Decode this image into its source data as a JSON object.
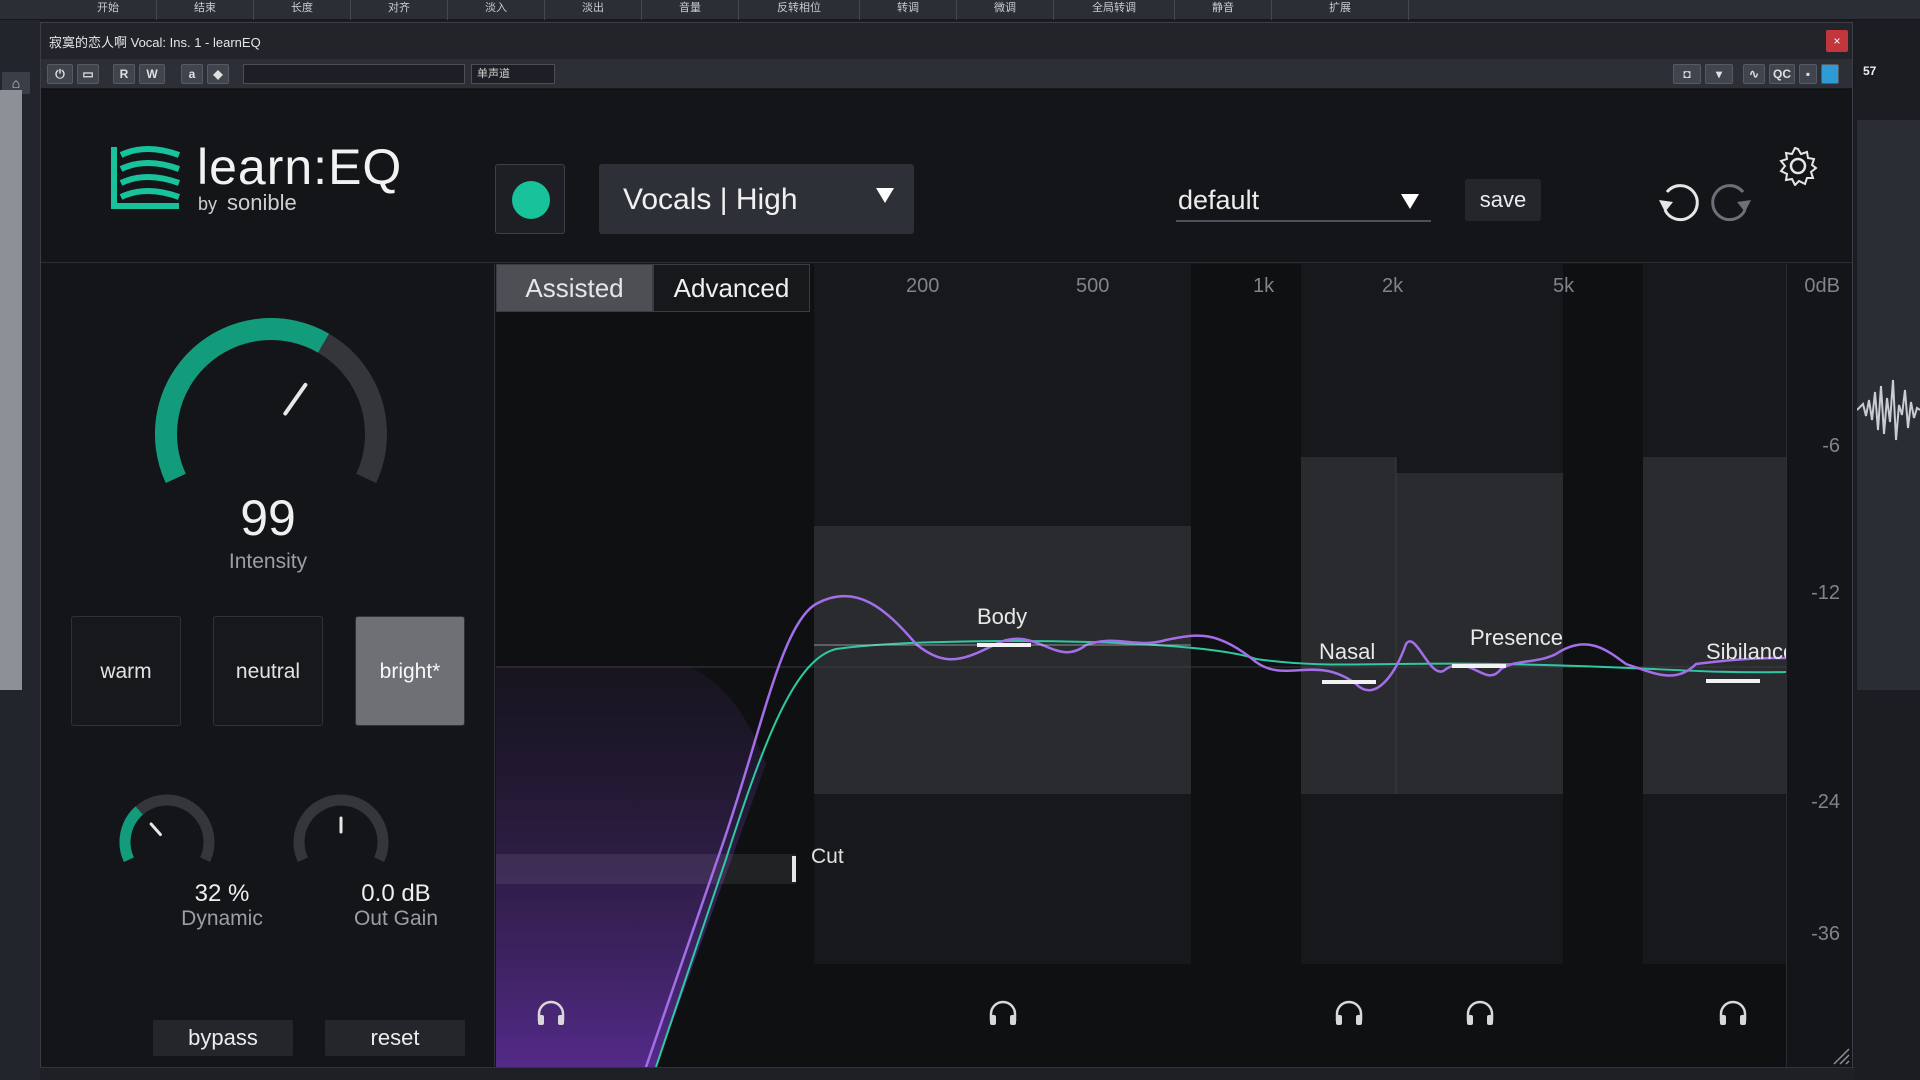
{
  "daw": {
    "menu": [
      "开始",
      "结束",
      "长度",
      "对齐",
      "淡入",
      "淡出",
      "音量",
      "反转相位",
      "转调",
      "微调",
      "全局转调",
      "静音",
      "扩展"
    ],
    "right_number": "57"
  },
  "window": {
    "title": "寂寞的恋人啊 Vocal: Ins. 1 - learnEQ",
    "close_label": "×",
    "toolbar": {
      "power": "⏻",
      "r": "R",
      "w": "W",
      "a": "a",
      "channel_mode": "单声道",
      "qc": "QC"
    }
  },
  "plugin": {
    "logo": {
      "name": "learn:EQ",
      "by": "by",
      "brand": "sonible"
    },
    "profile": "Vocals | High",
    "preset": "default",
    "save_label": "save",
    "intensity": {
      "value": "99",
      "label": "Intensity",
      "fraction": 0.99
    },
    "styles": [
      {
        "label": "warm",
        "active": false
      },
      {
        "label": "neutral",
        "active": false
      },
      {
        "label": "bright*",
        "active": true
      }
    ],
    "dynamic": {
      "value": "32 %",
      "label": "Dynamic",
      "fraction": 0.32
    },
    "out_gain": {
      "value": "0.0 dB",
      "label": "Out Gain",
      "fraction": 0.5
    },
    "bypass_label": "bypass",
    "reset_label": "reset",
    "tabs": [
      "Assisted",
      "Advanced"
    ],
    "freq_labels": [
      "200",
      "500",
      "1k",
      "2k",
      "5k"
    ],
    "db_labels": [
      "0dB",
      "-6",
      "-12",
      "-24",
      "-36"
    ],
    "bands": [
      "Body",
      "Nasal",
      "Presence",
      "Sibilance"
    ],
    "cut_label": "Cut",
    "colors": {
      "accent": "#18c29a",
      "curve": "#a46ee8",
      "target": "#2ec9a3"
    }
  }
}
